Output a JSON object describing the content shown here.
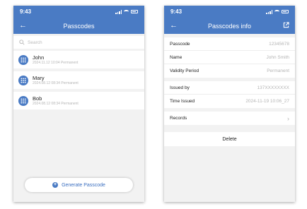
{
  "colors": {
    "accent": "#4a7bc4",
    "background": "#f2f2f2"
  },
  "left_screen": {
    "status_time": "9:43",
    "title": "Passcodes",
    "search_placeholder": "Search",
    "passcodes": [
      {
        "name": "John",
        "meta": "2024.11.12 10:04 Permanent"
      },
      {
        "name": "Mary",
        "meta": "2024.08.12 08:34 Permanent"
      },
      {
        "name": "Bob",
        "meta": "2024.08.12 08:34 Permanent"
      }
    ],
    "generate_button": "Generate Passcode"
  },
  "right_screen": {
    "status_time": "9:43",
    "title": "Passcodes info",
    "group1": [
      {
        "label": "Passcode",
        "value": "12345678"
      },
      {
        "label": "Name",
        "value": "John Smith"
      },
      {
        "label": "Validity Period",
        "value": "Permanent"
      }
    ],
    "group2": [
      {
        "label": "Issued by",
        "value": "137XXXXXXXX"
      },
      {
        "label": "Time Issued",
        "value": "2024-11-19 10:06_27"
      }
    ],
    "records_label": "Records",
    "delete_label": "Delete"
  }
}
